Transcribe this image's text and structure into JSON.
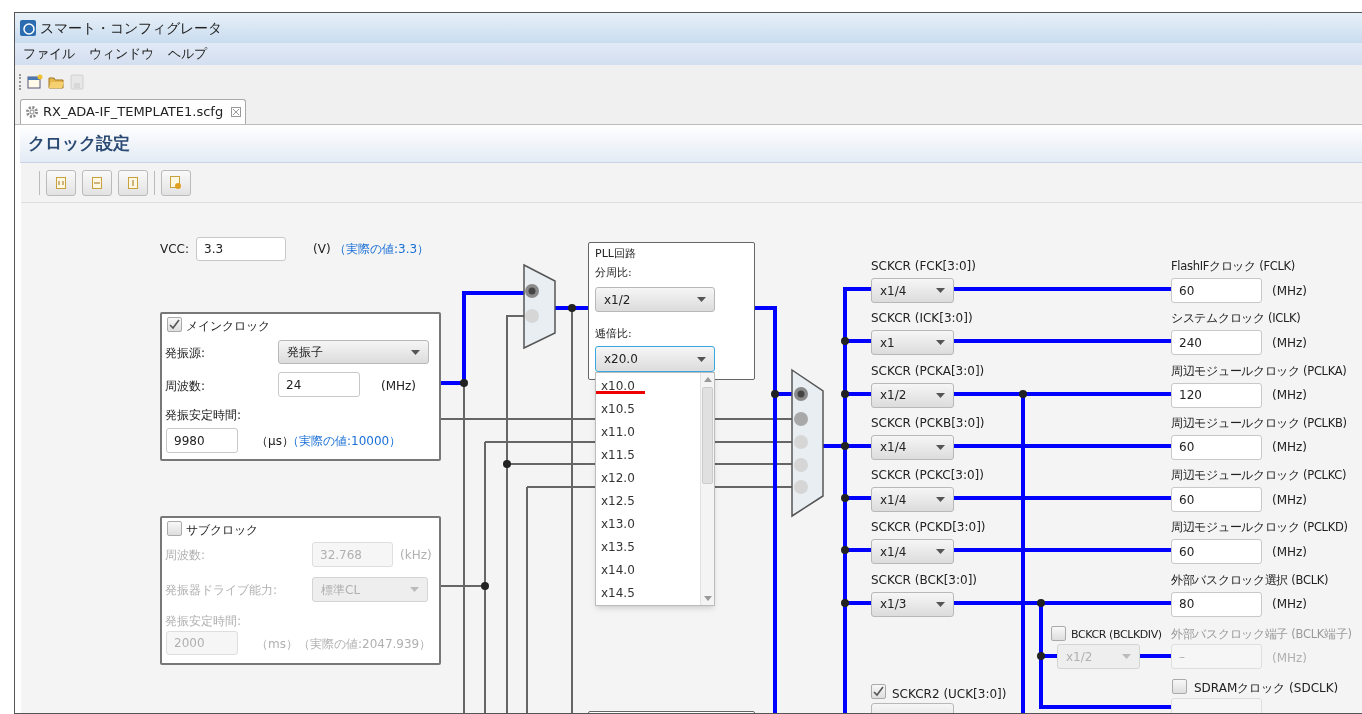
{
  "window": {
    "title": "スマート・コンフィグレータ"
  },
  "menu": [
    "ファイル",
    "ウィンドウ",
    "ヘルプ"
  ],
  "toolbar": [
    {
      "kind": "new",
      "disabled": false
    },
    {
      "kind": "open",
      "disabled": false
    },
    {
      "kind": "save",
      "disabled": true
    }
  ],
  "editor_tab": {
    "label": "RX_ADA-IF_TEMPLATE1.scfg"
  },
  "page_title": "クロック設定",
  "vcc": {
    "label": "VCC:",
    "value": "3.3",
    "unit": "(V)",
    "actual": "（実際の値:3.3）"
  },
  "main_clock": {
    "label": "メインクロック",
    "checked": true,
    "enabled": true,
    "source_label": "発振源:",
    "source_value": "発振子",
    "freq_label": "周波数:",
    "freq_value": "24",
    "freq_unit": "(MHz)",
    "stab_label": "発振安定時間:",
    "stab_value": "9980",
    "stab_unit": "（μs）",
    "stab_actual": "（実際の値:10000）"
  },
  "sub_clock": {
    "label": "サブクロック",
    "checked": false,
    "enabled": false,
    "freq_label": "周波数:",
    "freq_value": "32.768",
    "freq_unit": "(kHz)",
    "drive_label": "発振器ドライブ能力:",
    "drive_value": "標準CL",
    "stab_label": "発振安定時間:",
    "stab_value": "2000",
    "stab_unit": "（ms）",
    "stab_actual": "（実際の値:2047.939）"
  },
  "pll": {
    "title": "PLL回路",
    "div_label": "分周比:",
    "div_value": "x1/2",
    "mul_label": "逓倍比:",
    "mul_value": "x20.0",
    "mul_open": true,
    "options": [
      {
        "label": "x10.0",
        "underlined": true
      },
      {
        "label": "x10.5",
        "underlined": false
      },
      {
        "label": "x11.0",
        "underlined": false
      },
      {
        "label": "x11.5",
        "underlined": false
      },
      {
        "label": "x12.0",
        "underlined": false
      },
      {
        "label": "x12.5",
        "underlined": false
      },
      {
        "label": "x13.0",
        "underlined": false
      },
      {
        "label": "x13.5",
        "underlined": false
      },
      {
        "label": "x14.0",
        "underlined": false
      },
      {
        "label": "x14.5",
        "underlined": false
      }
    ]
  },
  "selectors": [
    {
      "inputs": [
        {
          "selected": true,
          "enabled": true
        },
        {
          "selected": false,
          "enabled": false
        }
      ]
    },
    {
      "inputs": [
        {
          "selected": true,
          "enabled": true
        },
        {
          "selected": false,
          "enabled": true
        },
        {
          "selected": false,
          "enabled": false
        },
        {
          "selected": false,
          "enabled": false
        },
        {
          "selected": false,
          "enabled": false
        }
      ]
    }
  ],
  "dividers": [
    {
      "label": "SCKCR (FCK[3:0])",
      "value": "x1/4"
    },
    {
      "label": "SCKCR (ICK[3:0])",
      "value": "x1"
    },
    {
      "label": "SCKCR (PCKA[3:0])",
      "value": "x1/2"
    },
    {
      "label": "SCKCR (PCKB[3:0])",
      "value": "x1/4"
    },
    {
      "label": "SCKCR (PCKC[3:0])",
      "value": "x1/4"
    },
    {
      "label": "SCKCR (PCKD[3:0])",
      "value": "x1/4"
    },
    {
      "label": "SCKCR (BCK[3:0])",
      "value": "x1/3"
    }
  ],
  "outputs": [
    {
      "label": "FlashIFクロック (FCLK)",
      "value": "60",
      "unit": "(MHz)"
    },
    {
      "label": "システムクロック (ICLK)",
      "value": "240",
      "unit": "(MHz)"
    },
    {
      "label": "周辺モジュールクロック (PCLKA)",
      "value": "120",
      "unit": "(MHz)"
    },
    {
      "label": "周辺モジュールクロック (PCLKB)",
      "value": "60",
      "unit": "(MHz)"
    },
    {
      "label": "周辺モジュールクロック (PCLKC)",
      "value": "60",
      "unit": "(MHz)"
    },
    {
      "label": "周辺モジュールクロック (PCLKD)",
      "value": "60",
      "unit": "(MHz)"
    },
    {
      "label": "外部バスクロック選択 (BCLK)",
      "value": "80",
      "unit": "(MHz)"
    }
  ],
  "bus_clock_pin": {
    "divider_label": "BCKCR (BCLKDIV)",
    "checked": false,
    "divider_value": "x1/2",
    "output_label": "外部バスクロック端子 (BCLK端子)",
    "output_value": "–",
    "unit": "(MHz)"
  },
  "sdram_clock": {
    "label": "SDRAMクロック (SDCLK)",
    "checked": false
  },
  "usb_divider": {
    "label": "SCKCR2 (UCK[3:0])",
    "checked": true
  }
}
